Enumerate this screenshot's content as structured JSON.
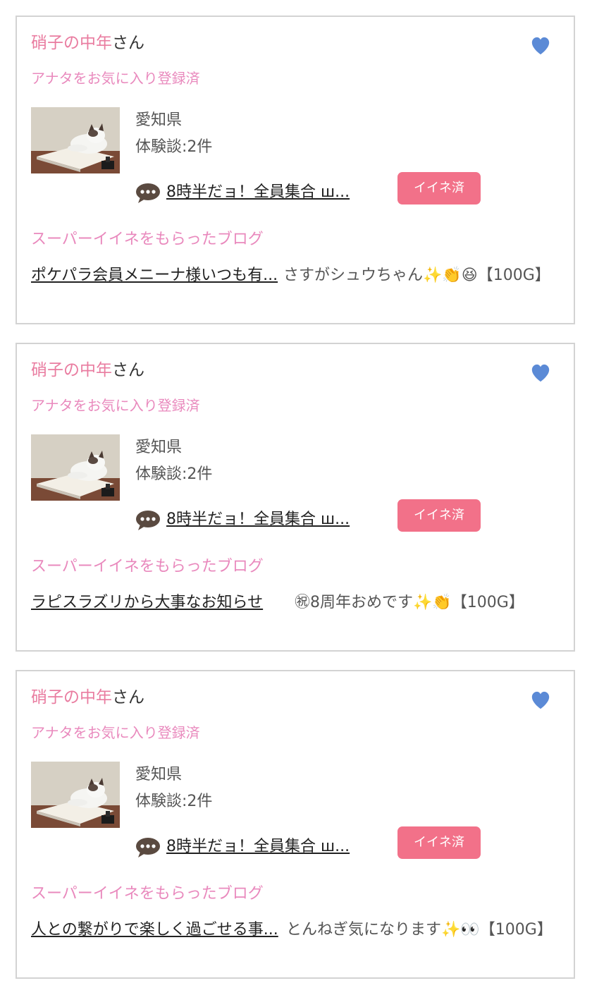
{
  "items": [
    {
      "user_name": "硝子の中年",
      "user_suffix": "さん",
      "favorite_status": "アナタをお気に入り登録済",
      "prefecture": "愛知県",
      "experience_count": "体験談:2件",
      "post_title": "8時半だョ！全員集合 ш...",
      "like_button_label": "イイネ済",
      "section_title": "スーパーイイネをもらったブログ",
      "blog_title": "ポケパラ会員メニーナ様いつも有...",
      "comment": "さすがシュウちゃん✨👏😆【100G】"
    },
    {
      "user_name": "硝子の中年",
      "user_suffix": "さん",
      "favorite_status": "アナタをお気に入り登録済",
      "prefecture": "愛知県",
      "experience_count": "体験談:2件",
      "post_title": "8時半だョ！全員集合 ш...",
      "like_button_label": "イイネ済",
      "section_title": "スーパーイイネをもらったブログ",
      "blog_title": "ラピスラズリから大事なお知らせ",
      "comment": "㊗8周年おめです✨👏【100G】"
    },
    {
      "user_name": "硝子の中年",
      "user_suffix": "さん",
      "favorite_status": "アナタをお気に入り登録済",
      "prefecture": "愛知県",
      "experience_count": "体験談:2件",
      "post_title": "8時半だョ！全員集合 ш...",
      "like_button_label": "イイネ済",
      "section_title": "スーパーイイネをもらったブログ",
      "blog_title": "人との繋がりで楽しく過ごせる事...",
      "comment": "とんねぎ気になります✨👀【100G】"
    }
  ],
  "colors": {
    "user_name": "#e97ca0",
    "favorite_status": "#e989bd",
    "like_button_bg": "#f27189",
    "heart": "#5b8ad6",
    "card_border": "#d3d3d3"
  },
  "icons": {
    "favorite": "heart-icon",
    "post": "speech-bubble-icon",
    "avatar": "cat-on-book-photo"
  }
}
